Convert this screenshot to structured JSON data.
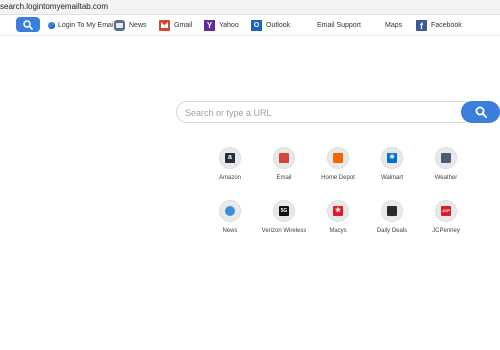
{
  "browser": {
    "url": "search.logintomyemailtab.com"
  },
  "toolbar": {
    "items": [
      {
        "label": "Login To My Email",
        "icon": "globe-icon"
      },
      {
        "label": "News",
        "icon": "news-icon"
      },
      {
        "label": "Gmail",
        "icon": "gmail-icon"
      },
      {
        "label": "Yahoo",
        "icon": "yahoo-icon",
        "icon_text": "Y"
      },
      {
        "label": "Outlook",
        "icon": "outlook-icon",
        "icon_text": "O"
      },
      {
        "label": "Email Support"
      },
      {
        "label": "Maps"
      },
      {
        "label": "Facebook",
        "icon": "facebook-icon",
        "icon_text": "f"
      }
    ]
  },
  "search": {
    "placeholder": "Search or type a URL",
    "value": ""
  },
  "tiles": [
    {
      "label": "Amazon",
      "icon": "amazon-icon",
      "glyph": "a",
      "color": "#232f3e"
    },
    {
      "label": "Email",
      "icon": "email-icon",
      "glyph": "",
      "color": "#d44638"
    },
    {
      "label": "Home Depot",
      "icon": "home-depot-icon",
      "glyph": "",
      "color": "#f96302"
    },
    {
      "label": "Walmart",
      "icon": "walmart-icon",
      "glyph": "✳",
      "color": "#0071ce"
    },
    {
      "label": "Weather",
      "icon": "weather-icon",
      "glyph": "",
      "color": "#4a5d73"
    },
    {
      "label": "News",
      "icon": "globe-icon",
      "glyph": "",
      "color": "#3b8fd9"
    },
    {
      "label": "Verizon Wireless",
      "icon": "verizon-5g-icon",
      "glyph": "5G",
      "color": "#111111"
    },
    {
      "label": "Macys",
      "icon": "macys-star-icon",
      "glyph": "★",
      "color": "#e21a2c"
    },
    {
      "label": "Daily Deals",
      "icon": "shopping-bag-icon",
      "glyph": "",
      "color": "#2b2b2b"
    },
    {
      "label": "JCPenney",
      "icon": "jcpenney-icon",
      "glyph": "JCP",
      "color": "#d6202f"
    }
  ]
}
